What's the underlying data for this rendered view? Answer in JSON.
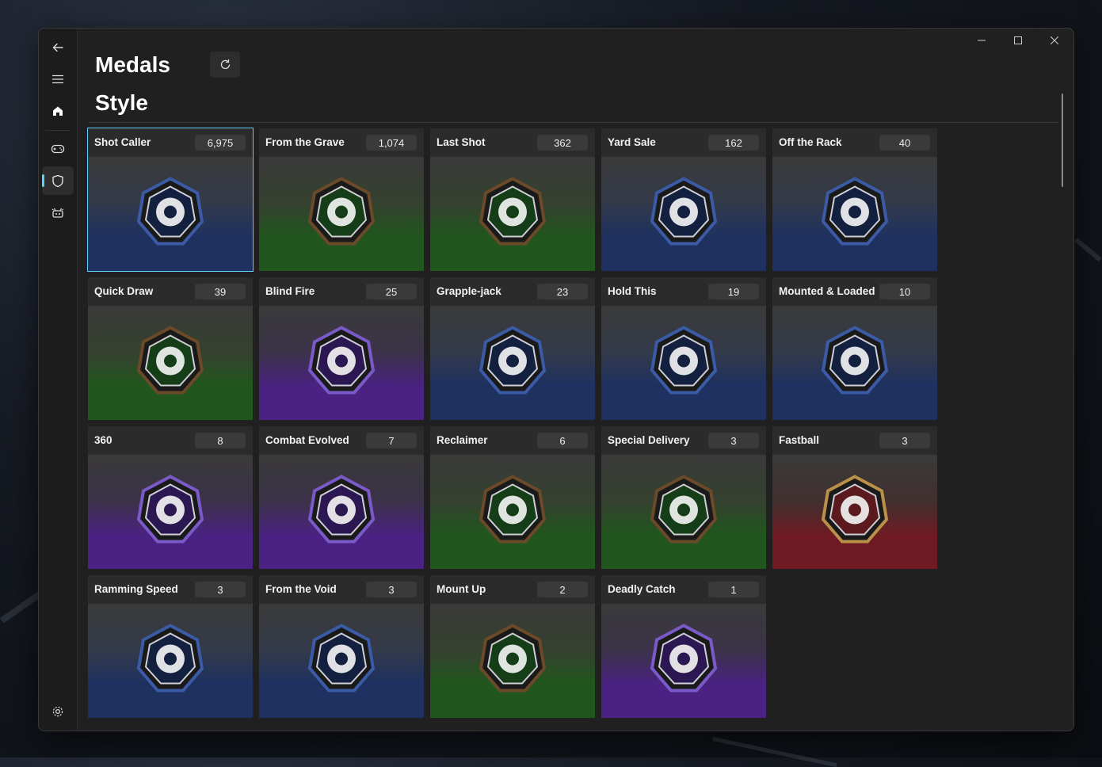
{
  "window": {
    "title": "Medals",
    "section": "Style"
  },
  "nav": {
    "items": [
      "back-icon",
      "menu-icon",
      "home-icon",
      "gamepad-icon",
      "shield-icon",
      "bot-icon",
      "settings-icon"
    ],
    "active": "shield-icon"
  },
  "colors": {
    "accent": "#60cdff",
    "tier_blue": "#1e3160",
    "tier_green": "#21561e",
    "tier_purple": "#4b2184",
    "tier_red": "#6f1a22"
  },
  "medals": [
    {
      "name": "Shot Caller",
      "count": "6,975",
      "tier": "blue",
      "icon": "skull-icon",
      "selected": true
    },
    {
      "name": "From the Grave",
      "count": "1,074",
      "tier": "green",
      "icon": "gravestone-icon"
    },
    {
      "name": "Last Shot",
      "count": "362",
      "tier": "green",
      "icon": "revolver-cylinder-icon"
    },
    {
      "name": "Yard Sale",
      "count": "162",
      "tier": "blue",
      "icon": "open-box-icon"
    },
    {
      "name": "Off the Rack",
      "count": "40",
      "tier": "blue",
      "icon": "weapon-rack-icon"
    },
    {
      "name": "Quick Draw",
      "count": "39",
      "tier": "green",
      "icon": "gunslinger-icon"
    },
    {
      "name": "Blind Fire",
      "count": "25",
      "tier": "purple",
      "icon": "visor-helmet-icon"
    },
    {
      "name": "Grapple-jack",
      "count": "23",
      "tier": "blue",
      "icon": "grappleshot-icon"
    },
    {
      "name": "Hold This",
      "count": "19",
      "tier": "blue",
      "icon": "thrown-rifle-icon"
    },
    {
      "name": "Mounted & Loaded",
      "count": "10",
      "tier": "blue",
      "icon": "turret-icon"
    },
    {
      "name": "360",
      "count": "8",
      "tier": "purple",
      "icon": "spin-ring-icon"
    },
    {
      "name": "Combat Evolved",
      "count": "7",
      "tier": "purple",
      "icon": "halo-ring-icon"
    },
    {
      "name": "Reclaimer",
      "count": "6",
      "tier": "green",
      "icon": "kick-figures-icon"
    },
    {
      "name": "Special Delivery",
      "count": "3",
      "tier": "green",
      "icon": "gift-grenade-icon"
    },
    {
      "name": "Fastball",
      "count": "3",
      "tier": "red",
      "icon": "baseball-grenade-icon"
    },
    {
      "name": "Ramming Speed",
      "count": "3",
      "tier": "blue",
      "icon": "ram-icon"
    },
    {
      "name": "From the Void",
      "count": "3",
      "tier": "blue",
      "icon": "void-spike-icon"
    },
    {
      "name": "Mount Up",
      "count": "2",
      "tier": "green",
      "icon": "fist-bump-icon"
    },
    {
      "name": "Deadly Catch",
      "count": "1",
      "tier": "purple",
      "icon": "fish-hook-icon"
    }
  ]
}
